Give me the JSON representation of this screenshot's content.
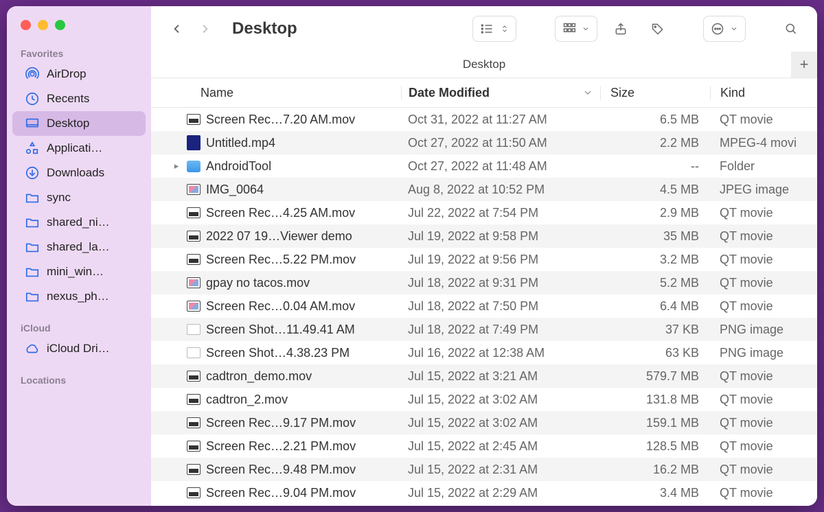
{
  "window_title": "Desktop",
  "subheader_title": "Desktop",
  "sidebar": {
    "sections": {
      "favorites": "Favorites",
      "icloud": "iCloud",
      "locations": "Locations"
    },
    "items": [
      {
        "label": "AirDrop",
        "icon": "airdrop"
      },
      {
        "label": "Recents",
        "icon": "clock"
      },
      {
        "label": "Desktop",
        "icon": "desktop",
        "selected": true
      },
      {
        "label": "Applicati…",
        "icon": "apps"
      },
      {
        "label": "Downloads",
        "icon": "download"
      },
      {
        "label": "sync",
        "icon": "folder"
      },
      {
        "label": "shared_ni…",
        "icon": "folder"
      },
      {
        "label": "shared_la…",
        "icon": "folder"
      },
      {
        "label": "mini_win…",
        "icon": "folder"
      },
      {
        "label": "nexus_ph…",
        "icon": "folder"
      }
    ],
    "icloud_items": [
      {
        "label": "iCloud Dri…",
        "icon": "icloud"
      }
    ]
  },
  "columns": {
    "name": "Name",
    "modified": "Date Modified",
    "size": "Size",
    "kind": "Kind"
  },
  "files": [
    {
      "name": "Screen Rec…7.20 AM.mov",
      "modified": "Oct 31, 2022 at 11:27 AM",
      "size": "6.5 MB",
      "kind": "QT movie",
      "icon": "vid"
    },
    {
      "name": "Untitled.mp4",
      "modified": "Oct 27, 2022 at 11:50 AM",
      "size": "2.2 MB",
      "kind": "MPEG-4 movi",
      "icon": "phone"
    },
    {
      "name": "AndroidTool",
      "modified": "Oct 27, 2022 at 11:48 AM",
      "size": "--",
      "kind": "Folder",
      "icon": "folder",
      "folder": true
    },
    {
      "name": "IMG_0064",
      "modified": "Aug 8, 2022 at 10:52 PM",
      "size": "4.5 MB",
      "kind": "JPEG image",
      "icon": "img"
    },
    {
      "name": "Screen Rec…4.25 AM.mov",
      "modified": "Jul 22, 2022 at 7:54 PM",
      "size": "2.9 MB",
      "kind": "QT movie",
      "icon": "vid"
    },
    {
      "name": "2022 07 19…Viewer demo",
      "modified": "Jul 19, 2022 at 9:58 PM",
      "size": "35 MB",
      "kind": "QT movie",
      "icon": "vid"
    },
    {
      "name": "Screen Rec…5.22 PM.mov",
      "modified": "Jul 19, 2022 at 9:56 PM",
      "size": "3.2 MB",
      "kind": "QT movie",
      "icon": "vid"
    },
    {
      "name": "gpay no tacos.mov",
      "modified": "Jul 18, 2022 at 9:31 PM",
      "size": "5.2 MB",
      "kind": "QT movie",
      "icon": "img"
    },
    {
      "name": "Screen Rec…0.04 AM.mov",
      "modified": "Jul 18, 2022 at 7:50 PM",
      "size": "6.4 MB",
      "kind": "QT movie",
      "icon": "img"
    },
    {
      "name": "Screen Shot…11.49.41 AM",
      "modified": "Jul 18, 2022 at 7:49 PM",
      "size": "37 KB",
      "kind": "PNG image",
      "icon": "shot"
    },
    {
      "name": "Screen Shot…4.38.23 PM",
      "modified": "Jul 16, 2022 at 12:38 AM",
      "size": "63 KB",
      "kind": "PNG image",
      "icon": "shot"
    },
    {
      "name": "cadtron_demo.mov",
      "modified": "Jul 15, 2022 at 3:21 AM",
      "size": "579.7 MB",
      "kind": "QT movie",
      "icon": "vid"
    },
    {
      "name": "cadtron_2.mov",
      "modified": "Jul 15, 2022 at 3:02 AM",
      "size": "131.8 MB",
      "kind": "QT movie",
      "icon": "vid"
    },
    {
      "name": "Screen Rec…9.17 PM.mov",
      "modified": "Jul 15, 2022 at 3:02 AM",
      "size": "159.1 MB",
      "kind": "QT movie",
      "icon": "vid"
    },
    {
      "name": "Screen Rec…2.21 PM.mov",
      "modified": "Jul 15, 2022 at 2:45 AM",
      "size": "128.5 MB",
      "kind": "QT movie",
      "icon": "vid"
    },
    {
      "name": "Screen Rec…9.48 PM.mov",
      "modified": "Jul 15, 2022 at 2:31 AM",
      "size": "16.2 MB",
      "kind": "QT movie",
      "icon": "vid"
    },
    {
      "name": "Screen Rec…9.04 PM.mov",
      "modified": "Jul 15, 2022 at 2:29 AM",
      "size": "3.4 MB",
      "kind": "QT movie",
      "icon": "vid"
    }
  ]
}
